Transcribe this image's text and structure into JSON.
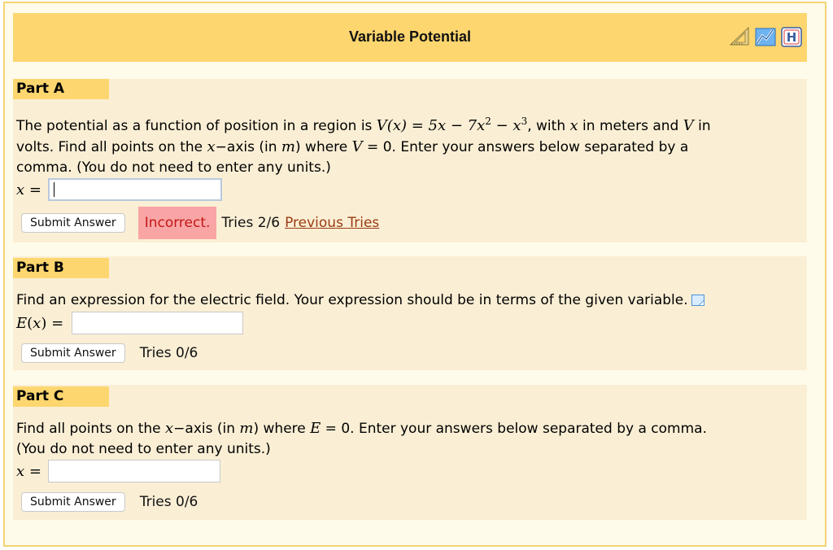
{
  "header": {
    "title": "Variable Potential",
    "icons": [
      "ruler-triangle-icon",
      "sketch-icon",
      "hint-h-icon"
    ]
  },
  "parts": [
    {
      "label": "Part A",
      "text_prefix": "The potential as a function of position in a region is ",
      "equation": "V(x) = 5x − 7x² − x³",
      "text_suffix_1": ", with ",
      "var_x": "x",
      "text_suffix_2": " in meters and ",
      "var_V": "V",
      "text_suffix_3": " in",
      "line2": "volts. Find all points on the ",
      "line2_axis": "x",
      "line2_b": "−axis (in ",
      "line2_unit": "m",
      "line2_c": ") where ",
      "line2_var": "V",
      "line2_d": " = 0. Enter your answers below separated by a",
      "line3": "comma. (You do not need to enter any units.)",
      "input_label": "x =",
      "input_value": "",
      "submit_label": "Submit Answer",
      "status_label": "Incorrect.",
      "tries": "Tries 2/6",
      "previous_tries": "Previous Tries"
    },
    {
      "label": "Part B",
      "text": "Find an expression for the electric field. Your expression should be in terms of the given variable.",
      "input_label": "E(x) =",
      "input_value": "",
      "submit_label": "Submit Answer",
      "tries": "Tries 0/6"
    },
    {
      "label": "Part C",
      "line1_a": "Find all points on the ",
      "line1_axis": "x",
      "line1_b": "−axis (in ",
      "line1_unit": "m",
      "line1_c": ") where ",
      "line1_var": "E",
      "line1_d": " = 0. Enter your answers below separated by a comma.",
      "line2": "(You do not need to enter any units.)",
      "input_label": "x =",
      "input_value": "",
      "submit_label": "Submit Answer",
      "tries": "Tries 0/6"
    }
  ],
  "colors": {
    "header_bg": "#fdd66f",
    "part_bg": "#faefd5",
    "frame_border": "#f4d474",
    "incorrect_bg": "#f9a5a5",
    "incorrect_text": "#c41717",
    "link": "#9b3b12"
  }
}
